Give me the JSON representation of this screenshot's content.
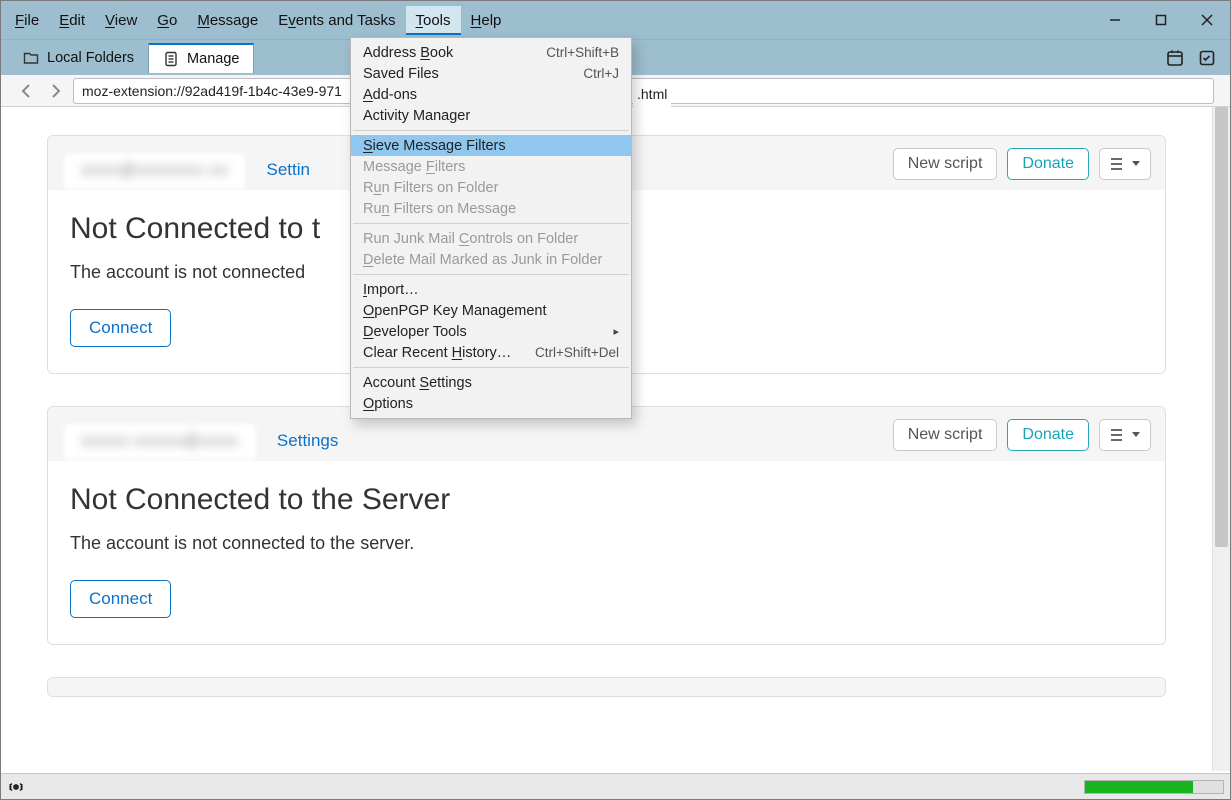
{
  "menubar": [
    {
      "label": "File",
      "ul": 0
    },
    {
      "label": "Edit",
      "ul": 0
    },
    {
      "label": "View",
      "ul": 0
    },
    {
      "label": "Go",
      "ul": 0
    },
    {
      "label": "Message",
      "ul": 0
    },
    {
      "label": "Events and Tasks",
      "ul": 1
    },
    {
      "label": "Tools",
      "ul": 0,
      "open": true
    },
    {
      "label": "Help",
      "ul": 0
    }
  ],
  "tabs": {
    "tab1_label": "Local Folders",
    "tab2_label": "Manage"
  },
  "url": "moz-extension://92ad419f-1b4c-43e9-971",
  "url_suffix": ".html",
  "tools_menu": [
    {
      "label": "Address Book",
      "shortcut": "Ctrl+Shift+B",
      "ul": 8
    },
    {
      "label": "Saved Files",
      "shortcut": "Ctrl+J",
      "ul": 11
    },
    {
      "label": "Add-ons",
      "ul": 0
    },
    {
      "label": "Activity Manager"
    },
    {
      "sep": true
    },
    {
      "label": "Sieve Message Filters",
      "highlight": true,
      "ul": 0
    },
    {
      "label": "Message Filters",
      "disabled": true,
      "ul": 8
    },
    {
      "label": "Run Filters on Folder",
      "disabled": true,
      "ul": 1
    },
    {
      "label": "Run Filters on Message",
      "disabled": true,
      "ul": 2
    },
    {
      "sep": true
    },
    {
      "label": "Run Junk Mail Controls on Folder",
      "disabled": true,
      "ul": 14
    },
    {
      "label": "Delete Mail Marked as Junk in Folder",
      "disabled": true,
      "ul": 0
    },
    {
      "sep": true
    },
    {
      "label": "Import…",
      "ul": 0
    },
    {
      "label": "OpenPGP Key Management",
      "ul": 0
    },
    {
      "label": "Developer Tools",
      "submenu": true,
      "ul": 0
    },
    {
      "label": "Clear Recent History…",
      "shortcut": "Ctrl+Shift+Del",
      "ul": 13
    },
    {
      "sep": true
    },
    {
      "label": "Account Settings",
      "ul": 8
    },
    {
      "label": "Options",
      "ul": 0
    }
  ],
  "cards": [
    {
      "account_blur": "xxxx@xxxxxxx.xx",
      "settings_label": "Settin",
      "new_script": "New script",
      "donate": "Donate",
      "heading": "Not Connected to t",
      "body": "The account is not connected",
      "connect": "Connect"
    },
    {
      "account_blur": "xxxxx-xxxxx@xxxx",
      "settings_label": "Settings",
      "new_script": "New script",
      "donate": "Donate",
      "heading": "Not Connected to the Server",
      "body": "The account is not connected to the server.",
      "connect": "Connect"
    }
  ]
}
